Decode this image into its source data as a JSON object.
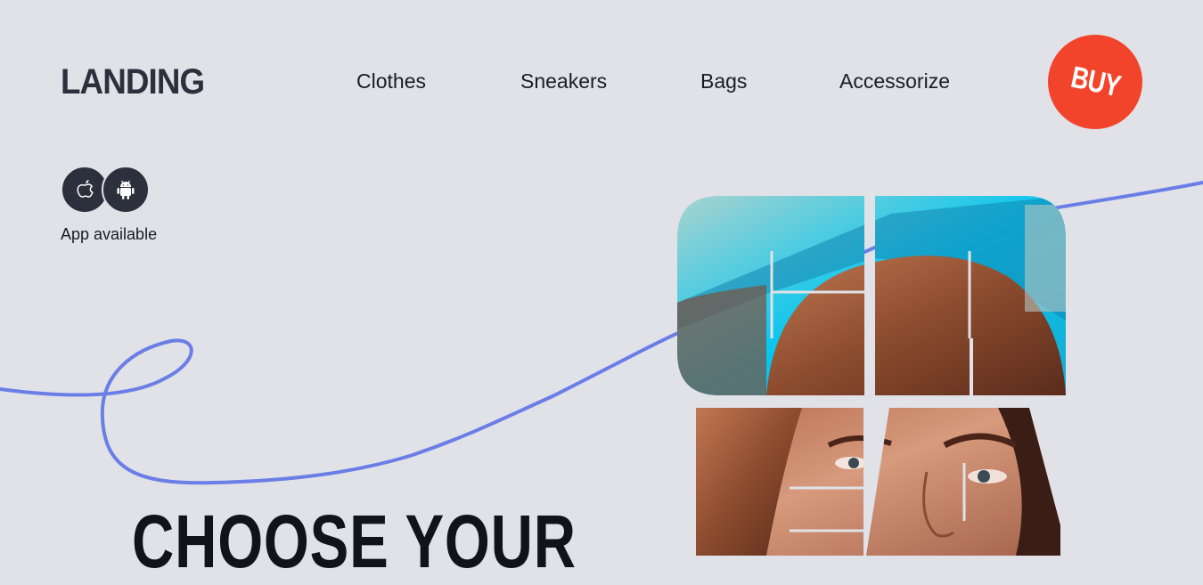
{
  "brand": {
    "logo": "LANDING"
  },
  "nav": {
    "items": [
      {
        "label": "Clothes"
      },
      {
        "label": "Sneakers"
      },
      {
        "label": "Bags"
      },
      {
        "label": "Accessorize"
      }
    ]
  },
  "buy_button": {
    "label": "BUY",
    "color": "#f2442b"
  },
  "apps": {
    "icons": [
      {
        "name": "apple-icon"
      },
      {
        "name": "android-icon"
      }
    ],
    "label": "App available"
  },
  "hero": {
    "headline": "CHOOSE YOUR",
    "accent_line_color": "#6a7ee6"
  },
  "colors": {
    "background": "#e1e2e8",
    "text": "#1a1c22",
    "dark": "#2c303c"
  }
}
